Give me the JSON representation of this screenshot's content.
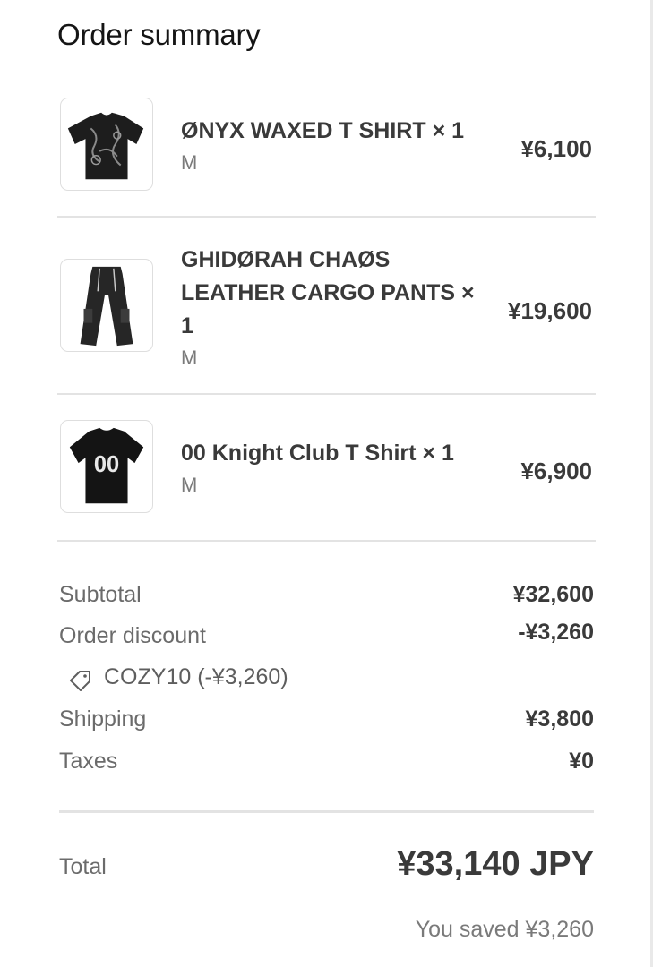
{
  "header": {
    "title": "Order summary"
  },
  "items": [
    {
      "name": "ØNYX WAXED T SHIRT × 1",
      "variant": "M",
      "price": "¥6,100",
      "image": "black-tshirt-graphic-icon"
    },
    {
      "name": "GHIDØRAH CHAØS LEATHER CARGO PANTS × 1",
      "variant": "M",
      "price": "¥19,600",
      "image": "black-cargo-pants-icon"
    },
    {
      "name": "00 Knight Club T Shirt × 1",
      "variant": "M",
      "price": "¥6,900",
      "image": "black-jersey-tshirt-icon"
    }
  ],
  "summary": {
    "subtotal_label": "Subtotal",
    "subtotal_value": "¥32,600",
    "discount_label": "Order discount",
    "discount_value": "-¥3,260",
    "discount_code": "COZY10 (-¥3,260)",
    "shipping_label": "Shipping",
    "shipping_value": "¥3,800",
    "taxes_label": "Taxes",
    "taxes_value": "¥0"
  },
  "total": {
    "label": "Total",
    "value": "¥33,140 JPY",
    "saved": "You saved ¥3,260"
  },
  "colors": {
    "text": "#3a3a3a",
    "muted": "#6b6b6b",
    "divider": "#e3e3e3"
  }
}
